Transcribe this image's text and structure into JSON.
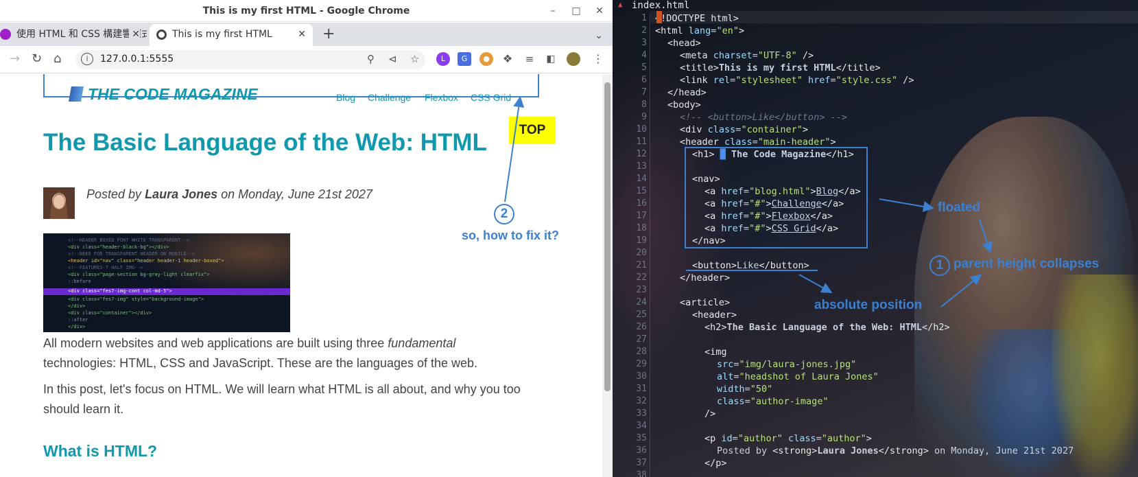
{
  "window": {
    "title": "This is my first HTML - Google Chrome"
  },
  "tabs": [
    {
      "label": "使用 HTML 和 CSS 構建響應式",
      "active": false,
      "favicon_color": "#a020c8"
    },
    {
      "label": "This is my first HTML",
      "active": true,
      "favicon_color": "#444444"
    }
  ],
  "toolbar": {
    "url": "127.0.0.1:5555"
  },
  "page": {
    "logo": "THE CODE MAGAZINE",
    "nav": [
      "Blog",
      "Challenge",
      "Flexbox",
      "CSS Grid"
    ],
    "top_button": "TOP",
    "title": "The Basic Language of the Web: HTML",
    "author_prefix": "Posted by ",
    "author_name": "Laura Jones",
    "author_suffix": " on Monday, June 21st 2027",
    "para1_a": "All modern websites and web applications are built using three ",
    "para1_em": "fundamental",
    "para1_b": " technologies: HTML, CSS and JavaScript. These are the languages of the web.",
    "para2": "In this post, let's focus on HTML. We will learn what HTML is all about, and why you too should learn it.",
    "heading3": "What is HTML?"
  },
  "annotations": {
    "num2": "2",
    "fix": "so, how to fix it?",
    "floated": "floated",
    "num1": "1",
    "collapse": "parent height collapses",
    "absolute": "absolute position"
  },
  "editor": {
    "filename": "index.html",
    "lines": [
      {
        "n": 1,
        "indent": 0,
        "html": "<span class='tg'>&lt;!DOCTYPE html&gt;</span>"
      },
      {
        "n": 2,
        "indent": 0,
        "html": "<span class='tg'>&lt;html</span> <span class='at'>lang</span>=<span class='st'>\"en\"</span><span class='tg'>&gt;</span>"
      },
      {
        "n": 3,
        "indent": 1,
        "html": "<span class='tg'>&lt;head&gt;</span>"
      },
      {
        "n": 4,
        "indent": 2,
        "html": "<span class='tg'>&lt;meta</span> <span class='at'>charset</span>=<span class='st'>\"UTF-8\"</span> <span class='tg'>/&gt;</span>"
      },
      {
        "n": 5,
        "indent": 2,
        "html": "<span class='tg'>&lt;title&gt;</span><b>This is my first HTML</b><span class='tg'>&lt;/title&gt;</span>"
      },
      {
        "n": 6,
        "indent": 2,
        "html": "<span class='tg'>&lt;link</span> <span class='at'>rel</span>=<span class='st'>\"stylesheet\"</span> <span class='at'>href</span>=<span class='st'>\"style.css\"</span> <span class='tg'>/&gt;</span>"
      },
      {
        "n": 7,
        "indent": 1,
        "html": "<span class='tg'>&lt;/head&gt;</span>"
      },
      {
        "n": 8,
        "indent": 1,
        "html": "<span class='tg'>&lt;body&gt;</span>"
      },
      {
        "n": 9,
        "indent": 2,
        "html": "<span class='cm'>&lt;!-- &lt;button&gt;Like&lt;/button&gt; --&gt;</span>"
      },
      {
        "n": 10,
        "indent": 2,
        "html": "<span class='tg'>&lt;div</span> <span class='at'>class</span>=<span class='st'>\"container\"</span><span class='tg'>&gt;</span>"
      },
      {
        "n": 11,
        "indent": 2,
        "html": "<span class='tg'>&lt;header</span> <span class='at'>class</span>=<span class='st'>\"main-header\"</span><span class='tg'>&gt;</span>"
      },
      {
        "n": 12,
        "indent": 3,
        "html": "<span class='tg'>&lt;h1&gt;</span> <span style='color:#4a8ef0'>&#9608;</span> <b>The Code Magazine</b><span class='tg'>&lt;/h1&gt;</span>"
      },
      {
        "n": 13,
        "indent": 0,
        "html": ""
      },
      {
        "n": 14,
        "indent": 3,
        "html": "<span class='tg'>&lt;nav&gt;</span>"
      },
      {
        "n": 15,
        "indent": 4,
        "html": "<span class='tg'>&lt;a</span> <span class='at'>href</span>=<span class='st'>\"blog.html\"</span><span class='tg'>&gt;</span><u>Blog</u><span class='tg'>&lt;/a&gt;</span>"
      },
      {
        "n": 16,
        "indent": 4,
        "html": "<span class='tg'>&lt;a</span> <span class='at'>href</span>=<span class='st'>\"#\"</span><span class='tg'>&gt;</span><u>Challenge</u><span class='tg'>&lt;/a&gt;</span>"
      },
      {
        "n": 17,
        "indent": 4,
        "html": "<span class='tg'>&lt;a</span> <span class='at'>href</span>=<span class='st'>\"#\"</span><span class='tg'>&gt;</span><u>Flexbox</u><span class='tg'>&lt;/a&gt;</span>"
      },
      {
        "n": 18,
        "indent": 4,
        "html": "<span class='tg'>&lt;a</span> <span class='at'>href</span>=<span class='st'>\"#\"</span><span class='tg'>&gt;</span><u>CSS Grid</u><span class='tg'>&lt;/a&gt;</span>"
      },
      {
        "n": 19,
        "indent": 3,
        "html": "<span class='tg'>&lt;/nav&gt;</span>"
      },
      {
        "n": 20,
        "indent": 0,
        "html": ""
      },
      {
        "n": 21,
        "indent": 3,
        "html": "<span class='tg'>&lt;button&gt;</span>Like<span class='tg'>&lt;/button&gt;</span>"
      },
      {
        "n": 22,
        "indent": 2,
        "html": "<span class='tg'>&lt;/header&gt;</span>"
      },
      {
        "n": 23,
        "indent": 0,
        "html": ""
      },
      {
        "n": 24,
        "indent": 2,
        "html": "<span class='tg'>&lt;article&gt;</span>"
      },
      {
        "n": 25,
        "indent": 3,
        "html": "<span class='tg'>&lt;header&gt;</span>"
      },
      {
        "n": 26,
        "indent": 4,
        "html": "<span class='tg'>&lt;h2&gt;</span><b>The Basic Language of the Web: HTML</b><span class='tg'>&lt;/h2&gt;</span>"
      },
      {
        "n": 27,
        "indent": 0,
        "html": ""
      },
      {
        "n": 28,
        "indent": 4,
        "html": "<span class='tg'>&lt;img</span>"
      },
      {
        "n": 29,
        "indent": 5,
        "html": "<span class='at'>src</span>=<span class='st'>\"img/laura-jones.jpg\"</span>"
      },
      {
        "n": 30,
        "indent": 5,
        "html": "<span class='at'>alt</span>=<span class='st'>\"headshot of Laura Jones\"</span>"
      },
      {
        "n": 31,
        "indent": 5,
        "html": "<span class='at'>width</span>=<span class='st'>\"50\"</span>"
      },
      {
        "n": 32,
        "indent": 5,
        "html": "<span class='at'>class</span>=<span class='st'>\"author-image\"</span>"
      },
      {
        "n": 33,
        "indent": 4,
        "html": "<span class='tg'>/&gt;</span>"
      },
      {
        "n": 34,
        "indent": 0,
        "html": ""
      },
      {
        "n": 35,
        "indent": 4,
        "html": "<span class='tg'>&lt;p</span> <span class='at'>id</span>=<span class='st'>\"author\"</span> <span class='at'>class</span>=<span class='st'>\"author\"</span><span class='tg'>&gt;</span>"
      },
      {
        "n": 36,
        "indent": 5,
        "html": "Posted by <span class='tg'>&lt;strong&gt;</span><b>Laura Jones</b><span class='tg'>&lt;/strong&gt;</span> on Monday, June 21st 2027"
      },
      {
        "n": 37,
        "indent": 4,
        "html": "<span class='tg'>&lt;/p&gt;</span>"
      },
      {
        "n": 38,
        "indent": 0,
        "html": ""
      }
    ]
  },
  "colors": {
    "accent": "#1098ad",
    "annotation": "#3c80d0",
    "top_button": "#ffff00"
  }
}
